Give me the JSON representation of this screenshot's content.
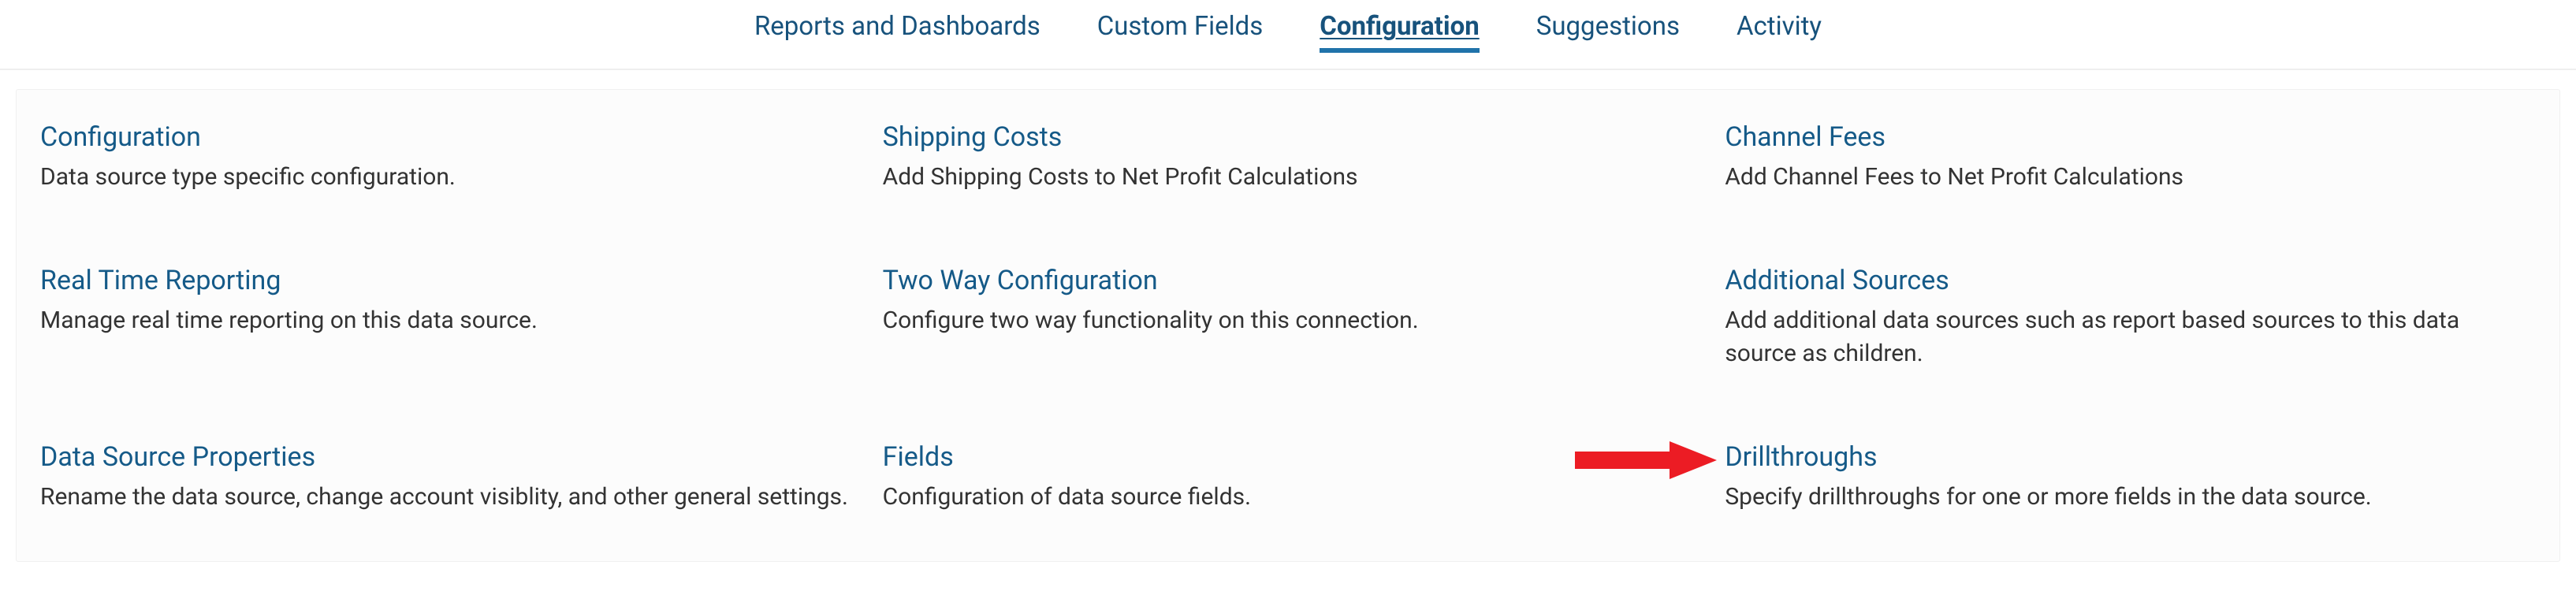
{
  "tabs": [
    {
      "label": "Reports and Dashboards",
      "active": false
    },
    {
      "label": "Custom Fields",
      "active": false
    },
    {
      "label": "Configuration",
      "active": true
    },
    {
      "label": "Suggestions",
      "active": false
    },
    {
      "label": "Activity",
      "active": false
    }
  ],
  "cards": [
    {
      "title": "Configuration",
      "desc": "Data source type specific configuration."
    },
    {
      "title": "Shipping Costs",
      "desc": "Add Shipping Costs to Net Profit Calculations"
    },
    {
      "title": "Channel Fees",
      "desc": "Add Channel Fees to Net Profit Calculations"
    },
    {
      "title": "Real Time Reporting",
      "desc": "Manage real time reporting on this data source."
    },
    {
      "title": "Two Way Configuration",
      "desc": "Configure two way functionality on this connection."
    },
    {
      "title": "Additional Sources",
      "desc": "Add additional data sources such as report based sources to this data source as children."
    },
    {
      "title": "Data Source Properties",
      "desc": "Rename the data source, change account visiblity, and other general settings."
    },
    {
      "title": "Fields",
      "desc": "Configuration of data source fields."
    },
    {
      "title": "Drillthroughs",
      "desc": "Specify drillthroughs for one or more fields in the data source."
    }
  ]
}
